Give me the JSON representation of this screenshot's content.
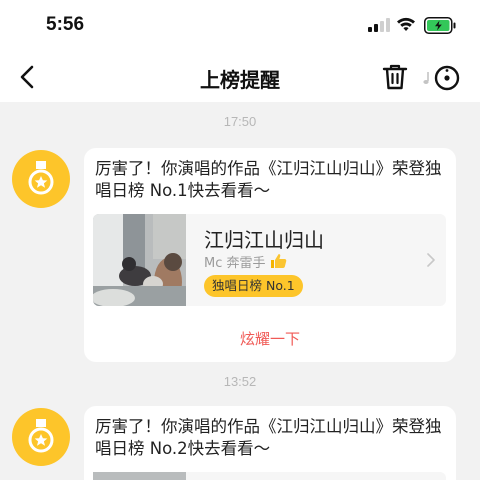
{
  "status_bar": {
    "time": "5:56"
  },
  "nav": {
    "title": "上榜提醒"
  },
  "messages": [
    {
      "time": "17:50",
      "text": "厉害了！你演唱的作品《江归江山归山》荣登独唱日榜 No.1快去看看～",
      "song": {
        "title": "江归江山归山",
        "singer": "Mc 奔雷手",
        "rank": "独唱日榜 No.1"
      },
      "action": "炫耀一下"
    },
    {
      "time": "13:52",
      "text": "厉害了！你演唱的作品《江归江山归山》荣登独唱日榜 No.2快去看看～"
    }
  ],
  "colors": {
    "accent_yellow": "#fdc52a",
    "action_red": "#f05a56",
    "battery_green": "#33c759"
  },
  "icons": [
    "back-icon",
    "trash-icon",
    "more-icon",
    "medal-icon",
    "thumbs-up-icon",
    "chevron-right-icon"
  ]
}
